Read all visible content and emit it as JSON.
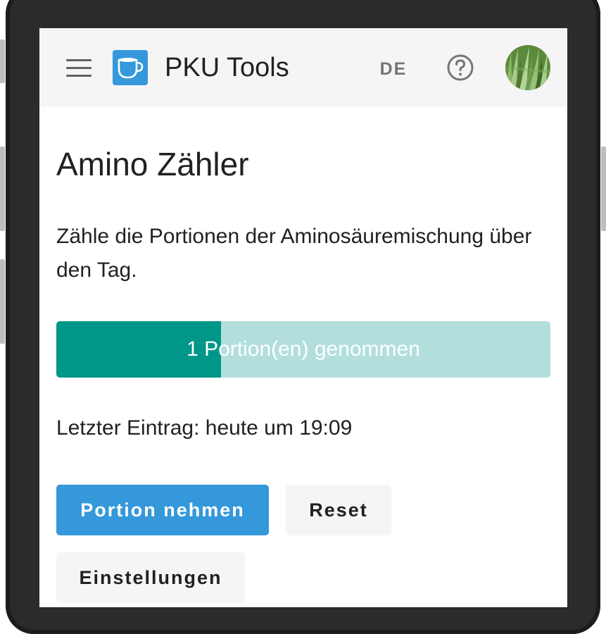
{
  "app": {
    "title": "PKU Tools",
    "language": "DE",
    "brand_color": "#3498db"
  },
  "icons": {
    "menu": "menu-icon",
    "logo": "cup-icon",
    "help": "help-circle-icon",
    "avatar": "grass-avatar"
  },
  "page": {
    "title": "Amino Zähler",
    "description": "Zähle die Portionen der Aminosäuremischung über den Tag.",
    "progress": {
      "label": "1 Portion(en) genommen",
      "fraction": 0.333,
      "fill_color": "#009688",
      "track_color": "#b2dfdb"
    },
    "last_entry": "Letzter Eintrag: heute um 19:09"
  },
  "buttons": {
    "take_portion": "Portion nehmen",
    "reset": "Reset",
    "settings": "Einstellungen"
  }
}
